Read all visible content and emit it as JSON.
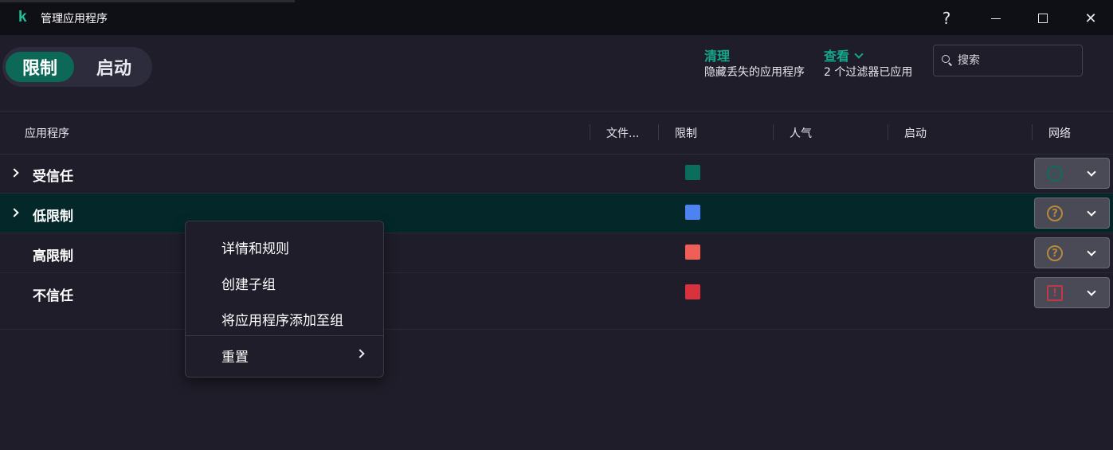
{
  "window": {
    "title": "管理应用程序",
    "logo": "k",
    "help_icon": "question-mark-icon",
    "help_label": "?",
    "close_label": "✕"
  },
  "mode_toggle": {
    "restrict_label": "限制",
    "startup_label": "启动",
    "active": "restrict"
  },
  "header_actions": {
    "clean_label": "清理",
    "clean_sub": "隐藏丢失的应用程序",
    "view_label": "查看",
    "view_sub": "2 个过滤器已应用"
  },
  "search": {
    "placeholder": "搜索"
  },
  "columns": {
    "app": "应用程序",
    "file": "文件...",
    "restrict": "限制",
    "popularity": "人气",
    "startup": "启动",
    "network": "网络"
  },
  "groups": [
    {
      "name": "受信任",
      "expandable": true,
      "color": "#0b6e5c",
      "network_icon": "check-circle-icon",
      "network_symbol": "✓",
      "selected": false
    },
    {
      "name": "低限制",
      "expandable": true,
      "color": "#4d82f3",
      "network_icon": "question-circle-icon",
      "network_symbol": "?",
      "selected": true
    },
    {
      "name": "高限制",
      "expandable": false,
      "color": "#f05e58",
      "network_icon": "question-circle-icon",
      "network_symbol": "?",
      "selected": false
    },
    {
      "name": "不信任",
      "expandable": false,
      "color": "#d9323f",
      "network_icon": "warning-square-icon",
      "network_symbol": "!",
      "selected": false
    }
  ],
  "context_menu": {
    "items": [
      "详情和规则",
      "创建子组",
      "将应用程序添加至组"
    ],
    "submenu_item": "重置"
  },
  "colors": {
    "accent": "#14a88c",
    "background": "#1e1d29",
    "selected_row": "#04282a"
  }
}
